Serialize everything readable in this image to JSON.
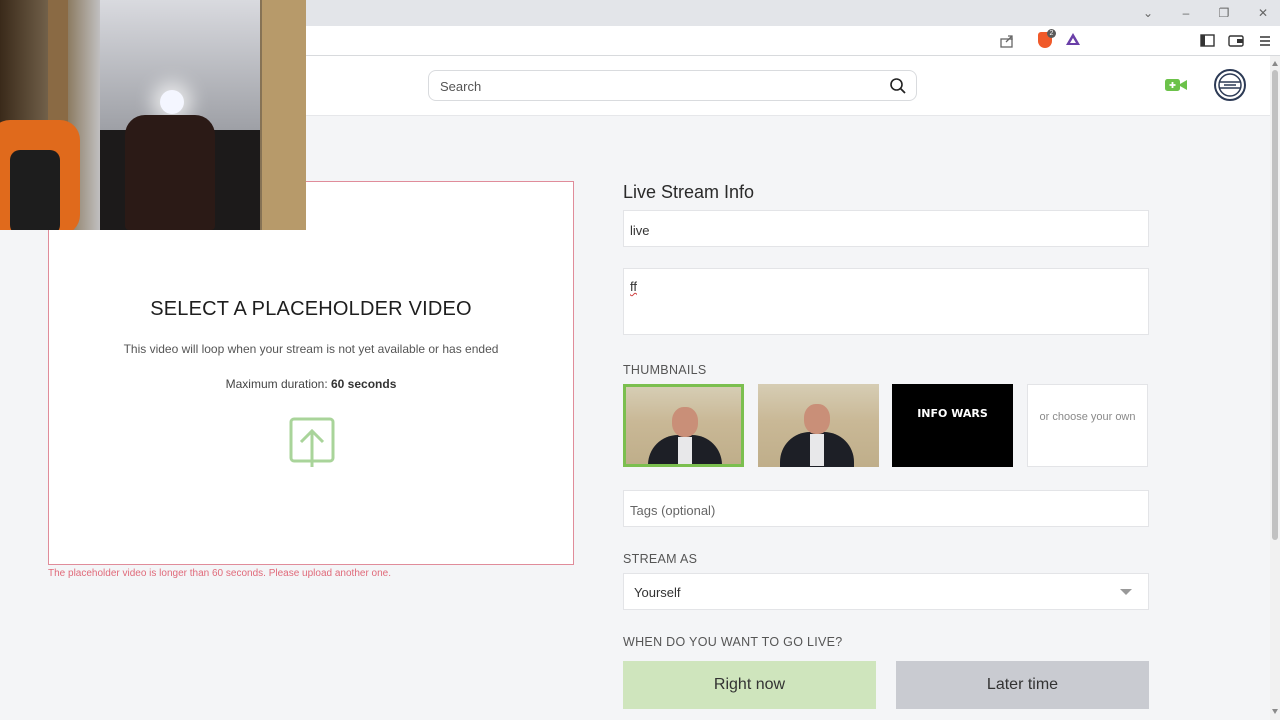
{
  "search": {
    "placeholder": "Search"
  },
  "dropzone": {
    "title": "SELECT A PLACEHOLDER VIDEO",
    "description": "This video will loop when your stream is not yet available or has ended",
    "duration_label": "Maximum duration: ",
    "duration_value": "60 seconds",
    "error": "The placeholder video is longer than 60 seconds. Please upload another one."
  },
  "form": {
    "title": "Live Stream Info",
    "stream_title_value": "live",
    "description_value": "ff",
    "thumbnails_label": "THUMBNAILS",
    "thumbnail_overlay_text": "INFO WARS",
    "choose_own": "or choose your own",
    "tags_placeholder": "Tags (optional)",
    "stream_as_label": "STREAM AS",
    "stream_as_value": "Yourself",
    "go_live_label": "WHEN DO YOU WANT TO GO LIVE?",
    "right_now": "Right now",
    "later_time": "Later time"
  },
  "browser": {
    "brave_badge": "2"
  },
  "colors": {
    "accent_green": "#7bbf4f",
    "error_pink": "#e06a7a",
    "live_icon_green": "#6cc24a"
  }
}
